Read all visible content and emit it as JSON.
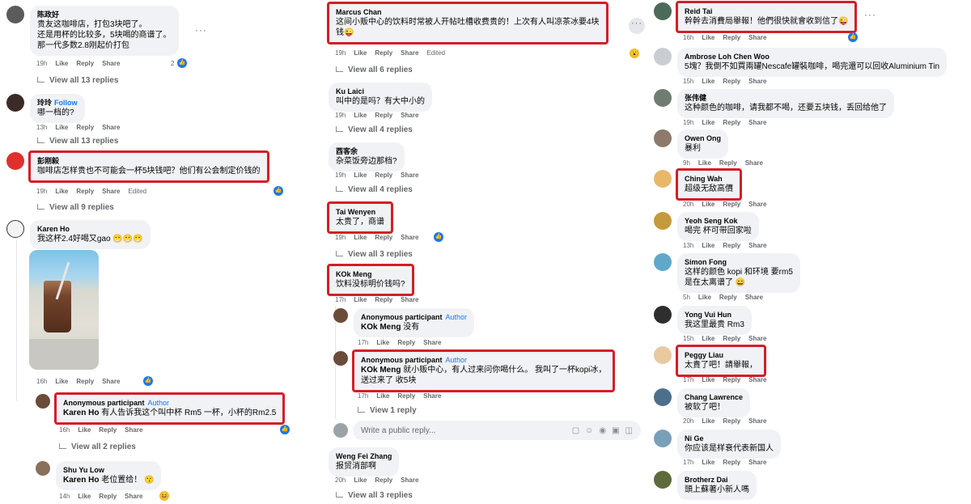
{
  "actions": {
    "like": "Like",
    "reply": "Reply",
    "share": "Share",
    "edited": "Edited"
  },
  "col1": {
    "c1": {
      "name": "陈政好",
      "lines": [
        "贵友这咖啡店，打包3块吧了。",
        "还是用杯的比较多，5块喝的商谱了。",
        "那一代多数2.8刚起价打包"
      ],
      "time": "19h",
      "reactions": "2",
      "replies": "View all 13 replies"
    },
    "c2": {
      "name": "玲玲",
      "follow": "Follow",
      "text": "哪一档的?",
      "time": "13h",
      "replies": "View all 13 replies"
    },
    "c3": {
      "name": "彭刚毅",
      "text": "咖啡店怎样贵也不可能会一杯5块钱吧？他们有公会制定价钱的",
      "time": "19h",
      "replies": "View all 9 replies"
    },
    "c4": {
      "name": "Karen Ho",
      "text": "我这杯2.4好喝又gao",
      "time": "16h"
    },
    "c5": {
      "name": "Anonymous participant",
      "author": "Author",
      "mention": "Karen Ho",
      "text": " 有人告诉我这个叫中杯 Rm5 一杯，小杯的Rm2.5",
      "time": "16h",
      "replies": "View all 2 replies"
    },
    "c6": {
      "name": "Shu Yu Low",
      "mention": "Karen Ho",
      "text": " 老位置给！",
      "time": "14h"
    }
  },
  "col2": {
    "c1": {
      "name": "Marcus Chan",
      "lines": [
        "这间小贩中心的饮料时常被人开帖吐槽收费贵的！上次有人叫凉茶冰要4块",
        "钱"
      ],
      "time": "19h",
      "replies": "View all 6 replies"
    },
    "c2": {
      "name": "Ku Laici",
      "text": "叫中的是吗？有大中小的",
      "time": "19h",
      "replies": "View all 4 replies"
    },
    "c3": {
      "name": "酉客余",
      "text": "杂菜饭旁边那档?",
      "time": "19h",
      "replies": "View all 4 replies"
    },
    "c4": {
      "name": "Tai Wenyen",
      "text": "太贵了，商谱",
      "time": "19h",
      "replies": "View all 3 replies"
    },
    "c5": {
      "name": "KOk Meng",
      "text": "饮料没标明价钱吗?",
      "time": "17h"
    },
    "c6": {
      "name": "Anonymous participant",
      "author": "Author",
      "mention": "KOk Meng",
      "text": " 没有",
      "time": "17h"
    },
    "c7": {
      "name": "Anonymous participant",
      "author": "Author",
      "mention": "KOk Meng",
      "lines": [
        " 就小贩中心，有人过来问你喝什么。 我叫了一杯kopi冰，",
        "送过来了 收5块"
      ],
      "time": "17h",
      "replies": "View 1 reply"
    },
    "reply_box": {
      "placeholder": "Write a public reply..."
    },
    "c8": {
      "name": "Weng Fei Zhang",
      "text": "报贸消部啊",
      "time": "20h",
      "replies": "View all 3 replies"
    }
  },
  "col3": {
    "c1": {
      "name": "Reid Tai",
      "text": "幹幹去消費局舉報！他們很快就會收到信了",
      "time": "16h"
    },
    "c2": {
      "name": "Ambrose Loh Chen Woo",
      "text": "5塊？我倒不如買兩罐Nescafe罐裝咖啡，喝完還可以回收Aluminium Tin",
      "time": "15h"
    },
    "c3": {
      "name": "张伟健",
      "text": "这种颜色的咖啡，请我都不喝，还要五块钱，丢回给他了",
      "time": "19h"
    },
    "c4": {
      "name": "Owen Ong",
      "text": "暴利",
      "time": "9h"
    },
    "c5": {
      "name": "Ching Wah",
      "text": "超级无敌高價",
      "time": "20h"
    },
    "c6": {
      "name": "Yeoh Seng Kok",
      "text": "喝完 杯可带回家啦",
      "time": "13h"
    },
    "c7": {
      "name": "Simon Fong",
      "lines": [
        "这样的颜色 kopi 和环境 要rm5",
        "是在太离谱了"
      ],
      "time": "5h"
    },
    "c8": {
      "name": "Yong Vui Hun",
      "text": "我这里最贵 Rm3",
      "time": "15h"
    },
    "c9": {
      "name": "Peggy Liau",
      "text": "太貴了吧！請舉報，",
      "time": "17h"
    },
    "c10": {
      "name": "Chang Lawrence",
      "text": "被软了吧！",
      "time": "20h"
    },
    "c11": {
      "name": "Ni Ge",
      "text": "你应该是样衰代表新国人",
      "time": "17h"
    },
    "c12": {
      "name": "Brotherz Dai",
      "text": "頭上蘇著小新人嗎",
      "time": ""
    }
  }
}
